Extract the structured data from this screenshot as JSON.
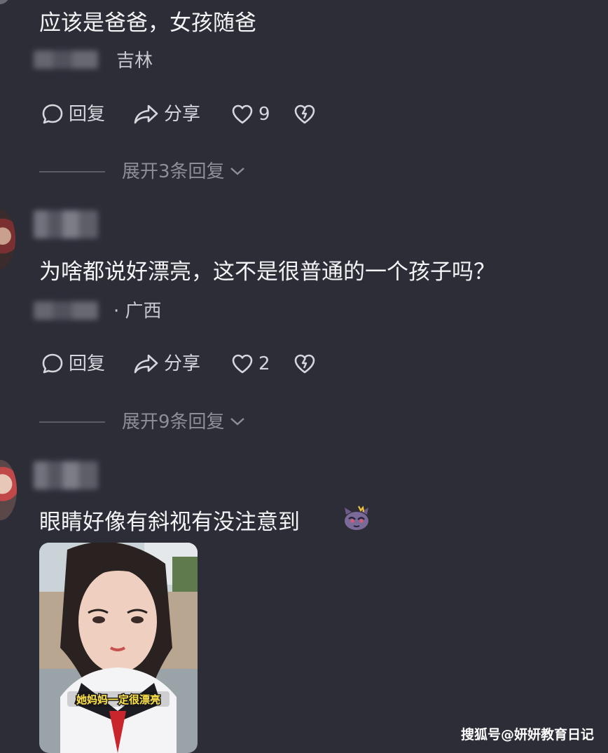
{
  "comments": [
    {
      "text": "应该是爸爸，女孩随爸",
      "location": "吉林",
      "reply_label": "回复",
      "share_label": "分享",
      "likes": "9",
      "expand_label": "展开3条回复"
    },
    {
      "text": "为啥都说好漂亮，这不是很普通的一个孩子吗？",
      "location": "· 广西",
      "reply_label": "回复",
      "share_label": "分享",
      "likes": "2",
      "expand_label": "展开9条回复"
    },
    {
      "text": "眼睛好像有斜视有没注意到",
      "emoji": "cat-face-emoji",
      "image_caption": "她妈妈一定很漂亮"
    }
  ],
  "watermark": "搜狐号@妍妍教育日记",
  "colors": {
    "background": "#2c2d37",
    "text": "#f4f4f7",
    "muted": "#8d8e96"
  },
  "icons": [
    "comment-bubble-icon",
    "share-arrow-icon",
    "heart-icon",
    "broken-heart-icon",
    "chevron-down-icon"
  ]
}
